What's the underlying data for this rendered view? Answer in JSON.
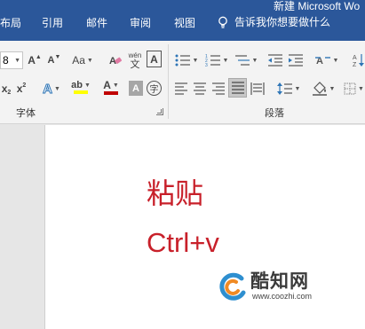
{
  "window": {
    "title_fragment": "新建 Microsoft Wo"
  },
  "tabs": [
    {
      "label": "布局"
    },
    {
      "label": "引用"
    },
    {
      "label": "邮件"
    },
    {
      "label": "审阅"
    },
    {
      "label": "视图"
    }
  ],
  "tell_me": {
    "placeholder": "告诉我你想要做什么",
    "icon": "lightbulb-icon"
  },
  "ribbon": {
    "font_group": {
      "label": "字体",
      "font_size_value": "8",
      "grow_label": "A",
      "shrink_label": "A",
      "change_case_label": "Aa",
      "phonetic_top": "wén",
      "phonetic_bottom": "文",
      "char_border_label": "A",
      "subscript_label": "x",
      "superscript_label": "x",
      "text_effects_label": "A",
      "highlight_label": "ab",
      "font_color_label": "A",
      "char_shading_label": "A",
      "enclose_label": "字",
      "highlight_color": "#ffff00",
      "font_color": "#c00000"
    },
    "paragraph_group": {
      "label": "段落"
    }
  },
  "document": {
    "line1": "粘贴",
    "line2": "Ctrl+v",
    "text_color": "#c8202a"
  },
  "watermark": {
    "title": "酷知网",
    "url": "www.coozhi.com"
  }
}
